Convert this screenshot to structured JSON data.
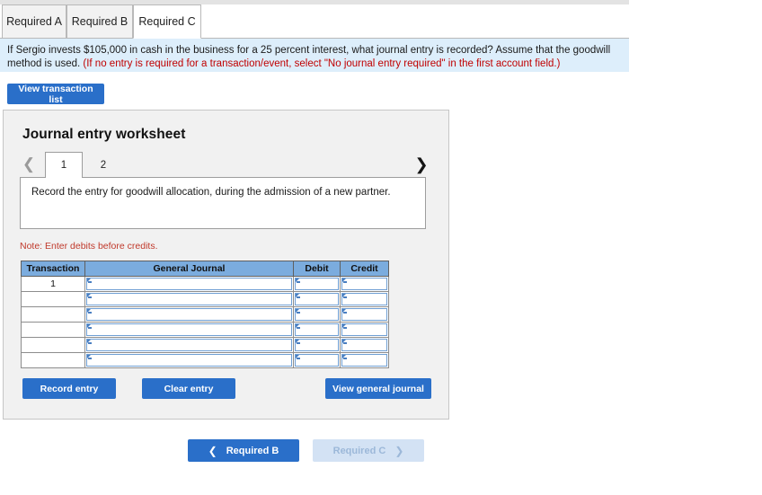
{
  "tabs": [
    {
      "label": "Required A",
      "active": false
    },
    {
      "label": "Required B",
      "active": false
    },
    {
      "label": "Required C",
      "active": true
    }
  ],
  "banner": {
    "question": "If Sergio invests $105,000 in cash in the business for a 25 percent interest, what journal entry is recorded? Assume that the goodwill method is used.",
    "hint": "(If no entry is required for a transaction/event, select \"No journal entry required\" in the first account field.)"
  },
  "toolbar": {
    "view_transaction_list": "View transaction list"
  },
  "worksheet": {
    "title": "Journal entry worksheet",
    "prev_icon": "chevron-left-icon",
    "next_icon": "chevron-right-icon",
    "pages": [
      {
        "label": "1",
        "active": true
      },
      {
        "label": "2",
        "active": false
      }
    ],
    "description": "Record the entry for goodwill allocation, during the admission of a new partner.",
    "note": "Note: Enter debits before credits."
  },
  "journal_table": {
    "columns": [
      "Transaction",
      "General Journal",
      "Debit",
      "Credit"
    ],
    "rows": [
      {
        "transaction": "1",
        "general_journal": "",
        "debit": "",
        "credit": ""
      },
      {
        "transaction": "",
        "general_journal": "",
        "debit": "",
        "credit": ""
      },
      {
        "transaction": "",
        "general_journal": "",
        "debit": "",
        "credit": ""
      },
      {
        "transaction": "",
        "general_journal": "",
        "debit": "",
        "credit": ""
      },
      {
        "transaction": "",
        "general_journal": "",
        "debit": "",
        "credit": ""
      },
      {
        "transaction": "",
        "general_journal": "",
        "debit": "",
        "credit": ""
      }
    ]
  },
  "actions": {
    "record_entry": "Record entry",
    "clear_entry": "Clear entry",
    "view_general_journal": "View general journal"
  },
  "footer_nav": {
    "prev_label": "Required B",
    "prev_icon": "chevron-left-icon",
    "next_label": "Required C",
    "next_icon": "chevron-right-icon",
    "next_disabled": true
  },
  "colors": {
    "accent_blue": "#2a6fc9",
    "banner_blue": "#ddeefb",
    "table_header_blue": "#7bacde",
    "note_red": "#c0392b",
    "panel_grey": "#f1f1f1",
    "disabled_blue": "#d3e2f4"
  }
}
